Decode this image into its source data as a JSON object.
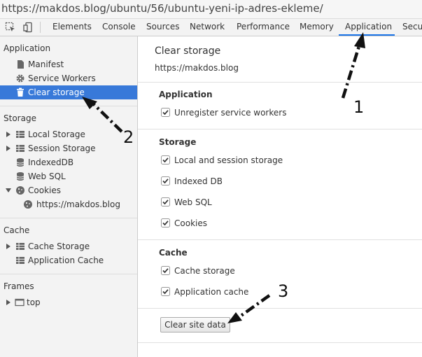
{
  "url": "https://makdos.blog/ubuntu/56/ubuntu-yeni-ip-adres-ekleme/",
  "devtools": {
    "icons": [
      "inspect-element-icon",
      "device-toolbar-icon"
    ],
    "tabs": [
      "Elements",
      "Console",
      "Sources",
      "Network",
      "Performance",
      "Memory",
      "Application",
      "Secur"
    ],
    "active_tab": "Application"
  },
  "sidebar": {
    "application": {
      "title": "Application",
      "items": [
        {
          "label": "Manifest",
          "icon": "document-icon"
        },
        {
          "label": "Service Workers",
          "icon": "gear-icon"
        },
        {
          "label": "Clear storage",
          "icon": "trash-icon",
          "selected": true
        }
      ]
    },
    "storage": {
      "title": "Storage",
      "items": [
        {
          "label": "Local Storage",
          "icon": "grid-icon",
          "expandable": true
        },
        {
          "label": "Session Storage",
          "icon": "grid-icon",
          "expandable": true
        },
        {
          "label": "IndexedDB",
          "icon": "database-icon"
        },
        {
          "label": "Web SQL",
          "icon": "database-icon"
        },
        {
          "label": "Cookies",
          "icon": "cookie-icon",
          "expanded": true
        },
        {
          "label": "https://makdos.blog",
          "icon": "cookie-icon",
          "child": true
        }
      ]
    },
    "cache": {
      "title": "Cache",
      "items": [
        {
          "label": "Cache Storage",
          "icon": "grid-icon",
          "expandable": true
        },
        {
          "label": "Application Cache",
          "icon": "grid-icon"
        }
      ]
    },
    "frames": {
      "title": "Frames",
      "items": [
        {
          "label": "top",
          "icon": "frame-icon",
          "expandable": true
        }
      ]
    }
  },
  "main": {
    "title": "Clear storage",
    "origin": "https://makdos.blog",
    "application": {
      "heading": "Application",
      "options": [
        {
          "label": "Unregister service workers",
          "checked": true
        }
      ]
    },
    "storage": {
      "heading": "Storage",
      "options": [
        {
          "label": "Local and session storage",
          "checked": true
        },
        {
          "label": "Indexed DB",
          "checked": true
        },
        {
          "label": "Web SQL",
          "checked": true
        },
        {
          "label": "Cookies",
          "checked": true
        }
      ]
    },
    "cache": {
      "heading": "Cache",
      "options": [
        {
          "label": "Cache storage",
          "checked": true
        },
        {
          "label": "Application cache",
          "checked": true
        }
      ]
    },
    "button_label": "Clear site data"
  },
  "annotations": [
    "1",
    "2",
    "3"
  ],
  "colors": {
    "selected": "#3879d9",
    "tab_underline": "#1a73e8"
  }
}
